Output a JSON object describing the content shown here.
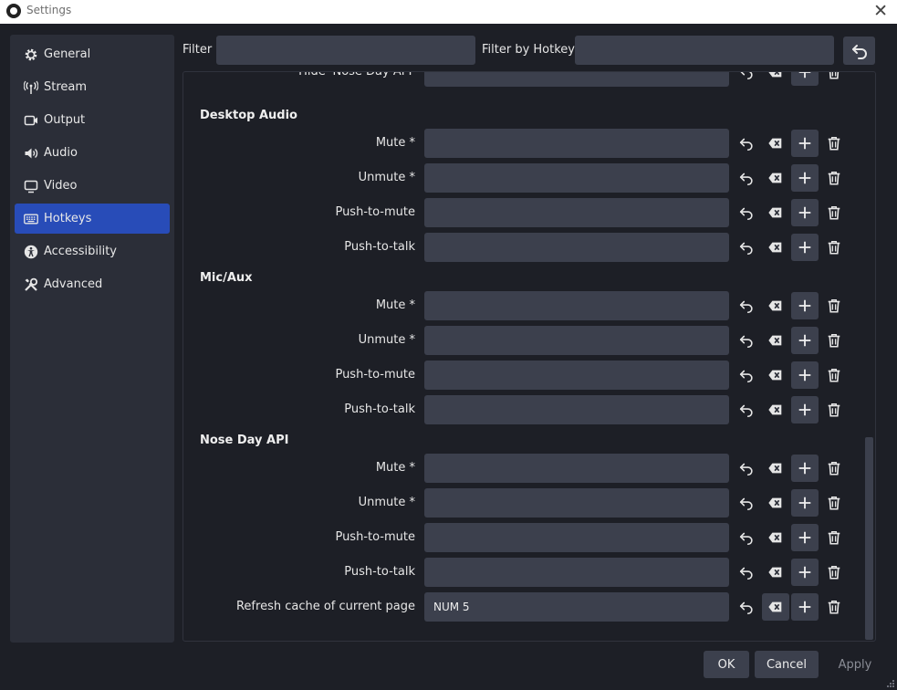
{
  "window": {
    "title": "Settings",
    "close_symbol": "✕"
  },
  "sidebar": {
    "items": [
      {
        "label": "General",
        "icon": "gear-icon",
        "active": false
      },
      {
        "label": "Stream",
        "icon": "antenna-icon",
        "active": false
      },
      {
        "label": "Output",
        "icon": "output-icon",
        "active": false
      },
      {
        "label": "Audio",
        "icon": "speaker-icon",
        "active": false
      },
      {
        "label": "Video",
        "icon": "monitor-icon",
        "active": false
      },
      {
        "label": "Hotkeys",
        "icon": "keyboard-icon",
        "active": true
      },
      {
        "label": "Accessibility",
        "icon": "accessibility-icon",
        "active": false
      },
      {
        "label": "Advanced",
        "icon": "tools-icon",
        "active": false
      }
    ]
  },
  "filters": {
    "filter_label": "Filter",
    "filter_value": "",
    "hotkey_label": "Filter by Hotkey",
    "hotkey_value": ""
  },
  "hotkeys": {
    "partial_row_label": "Hide 'Nose Day API'",
    "groups": [
      {
        "title": "Desktop Audio",
        "rows": [
          {
            "label": "Mute *",
            "key": ""
          },
          {
            "label": "Unmute *",
            "key": ""
          },
          {
            "label": "Push-to-mute",
            "key": ""
          },
          {
            "label": "Push-to-talk",
            "key": ""
          }
        ]
      },
      {
        "title": "Mic/Aux",
        "rows": [
          {
            "label": "Mute *",
            "key": ""
          },
          {
            "label": "Unmute *",
            "key": ""
          },
          {
            "label": "Push-to-mute",
            "key": ""
          },
          {
            "label": "Push-to-talk",
            "key": ""
          }
        ]
      },
      {
        "title": "Nose Day API",
        "rows": [
          {
            "label": "Mute *",
            "key": ""
          },
          {
            "label": "Unmute *",
            "key": ""
          },
          {
            "label": "Push-to-mute",
            "key": ""
          },
          {
            "label": "Push-to-talk",
            "key": ""
          },
          {
            "label": "Refresh cache of current page",
            "key": "NUM 5"
          }
        ]
      }
    ]
  },
  "buttons": {
    "ok": "OK",
    "cancel": "Cancel",
    "apply": "Apply"
  },
  "colors": {
    "accent": "#284cb8",
    "field": "#3c404d",
    "background": "#1d1f26",
    "sidebar": "#2b2e38"
  }
}
